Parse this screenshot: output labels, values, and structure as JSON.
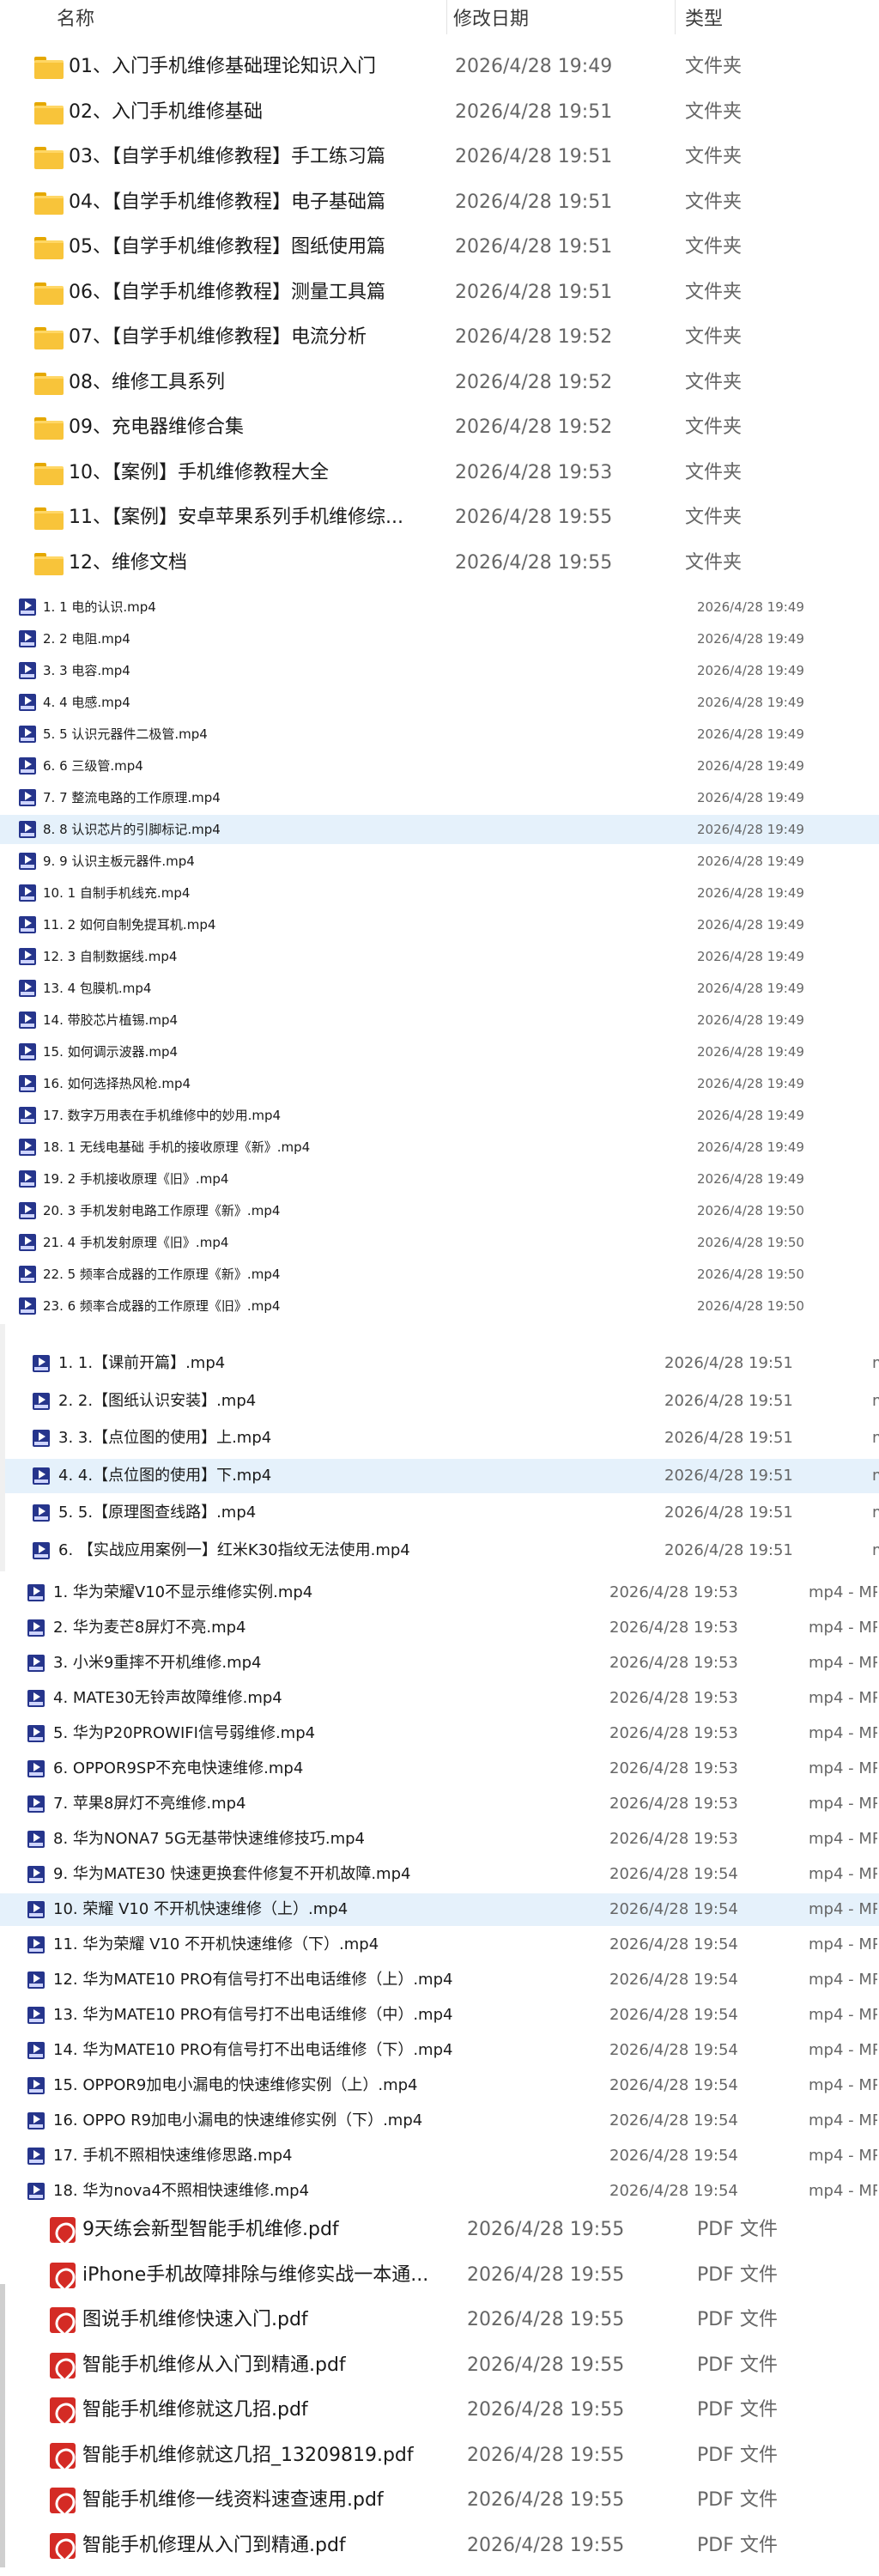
{
  "header": {
    "name": "名称",
    "date": "修改日期",
    "type": "类型"
  },
  "folders": [
    {
      "name": "01、入门手机维修基础理论知识入门",
      "date": "2026/4/28 19:49",
      "type": "文件夹"
    },
    {
      "name": "02、入门手机维修基础",
      "date": "2026/4/28 19:51",
      "type": "文件夹"
    },
    {
      "name": "03、【自学手机维修教程】手工练习篇",
      "date": "2026/4/28 19:51",
      "type": "文件夹"
    },
    {
      "name": "04、【自学手机维修教程】电子基础篇",
      "date": "2026/4/28 19:51",
      "type": "文件夹"
    },
    {
      "name": "05、【自学手机维修教程】图纸使用篇",
      "date": "2026/4/28 19:51",
      "type": "文件夹"
    },
    {
      "name": "06、【自学手机维修教程】测量工具篇",
      "date": "2026/4/28 19:51",
      "type": "文件夹"
    },
    {
      "name": "07、【自学手机维修教程】电流分析",
      "date": "2026/4/28 19:52",
      "type": "文件夹"
    },
    {
      "name": "08、维修工具系列",
      "date": "2026/4/28 19:52",
      "type": "文件夹"
    },
    {
      "name": "09、充电器维修合集",
      "date": "2026/4/28 19:52",
      "type": "文件夹"
    },
    {
      "name": "10、【案例】手机维修教程大全",
      "date": "2026/4/28 19:53",
      "type": "文件夹"
    },
    {
      "name": "11、【案例】安卓苹果系列手机维修综...",
      "date": "2026/4/28 19:55",
      "type": "文件夹"
    },
    {
      "name": "12、维修文档",
      "date": "2026/4/28 19:55",
      "type": "文件夹"
    }
  ],
  "videos_a": [
    {
      "name": "1. 1 电的认识.mp4",
      "date": "2026/4/28 19:49"
    },
    {
      "name": "2. 2 电阻.mp4",
      "date": "2026/4/28 19:49"
    },
    {
      "name": "3. 3 电容.mp4",
      "date": "2026/4/28 19:49"
    },
    {
      "name": "4. 4 电感.mp4",
      "date": "2026/4/28 19:49"
    },
    {
      "name": "5. 5 认识元器件二极管.mp4",
      "date": "2026/4/28 19:49"
    },
    {
      "name": "6. 6 三级管.mp4",
      "date": "2026/4/28 19:49"
    },
    {
      "name": "7. 7 整流电路的工作原理.mp4",
      "date": "2026/4/28 19:49"
    },
    {
      "name": "8. 8 认识芯片的引脚标记.mp4",
      "date": "2026/4/28 19:49",
      "selected": true
    },
    {
      "name": "9. 9 认识主板元器件.mp4",
      "date": "2026/4/28 19:49"
    },
    {
      "name": "10. 1 自制手机线充.mp4",
      "date": "2026/4/28 19:49"
    },
    {
      "name": "11. 2 如何自制免提耳机.mp4",
      "date": "2026/4/28 19:49"
    },
    {
      "name": "12. 3 自制数据线.mp4",
      "date": "2026/4/28 19:49"
    },
    {
      "name": "13. 4 包膜机.mp4",
      "date": "2026/4/28 19:49"
    },
    {
      "name": "14. 带胶芯片植锡.mp4",
      "date": "2026/4/28 19:49"
    },
    {
      "name": "15. 如何调示波器.mp4",
      "date": "2026/4/28 19:49"
    },
    {
      "name": "16. 如何选择热风枪.mp4",
      "date": "2026/4/28 19:49"
    },
    {
      "name": "17. 数字万用表在手机维修中的妙用.mp4",
      "date": "2026/4/28 19:49"
    },
    {
      "name": "18. 1 无线电基础 手机的接收原理《新》.mp4",
      "date": "2026/4/28 19:49"
    },
    {
      "name": "19. 2 手机接收原理《旧》.mp4",
      "date": "2026/4/28 19:49"
    },
    {
      "name": "20. 3 手机发射电路工作原理《新》.mp4",
      "date": "2026/4/28 19:50"
    },
    {
      "name": "21. 4 手机发射原理《旧》.mp4",
      "date": "2026/4/28 19:50"
    },
    {
      "name": "22. 5 频率合成器的工作原理《新》.mp4",
      "date": "2026/4/28 19:50"
    },
    {
      "name": "23. 6 频率合成器的工作原理《旧》.mp4",
      "date": "2026/4/28 19:50"
    }
  ],
  "videos_b": [
    {
      "name": "1. 1.【课前开篇】.mp4",
      "date": "2026/4/28 19:51",
      "type": "m"
    },
    {
      "name": "2. 2.【图纸认识安装】.mp4",
      "date": "2026/4/28 19:51",
      "type": "m"
    },
    {
      "name": "3. 3.【点位图的使用】上.mp4",
      "date": "2026/4/28 19:51",
      "type": "m"
    },
    {
      "name": "4. 4.【点位图的使用】下.mp4",
      "date": "2026/4/28 19:51",
      "type": "m",
      "selected": true
    },
    {
      "name": "5. 5.【原理图查线路】.mp4",
      "date": "2026/4/28 19:51",
      "type": "m"
    },
    {
      "name": "6. 【实战应用案例一】红米K30指纹无法使用.mp4",
      "date": "2026/4/28 19:51",
      "type": "m"
    }
  ],
  "videos_c": [
    {
      "name": "1. 华为荣耀V10不显示维修实例.mp4",
      "date": "2026/4/28 19:53",
      "type": "mp4 - MP"
    },
    {
      "name": "2. 华为麦芒8屏灯不亮.mp4",
      "date": "2026/4/28 19:53",
      "type": "mp4 - MP"
    },
    {
      "name": "3. 小米9重摔不开机维修.mp4",
      "date": "2026/4/28 19:53",
      "type": "mp4 - MP"
    },
    {
      "name": "4. MATE30无铃声故障维修.mp4",
      "date": "2026/4/28 19:53",
      "type": "mp4 - MP"
    },
    {
      "name": "5. 华为P20PROWIFI信号弱维修.mp4",
      "date": "2026/4/28 19:53",
      "type": "mp4 - MP"
    },
    {
      "name": "6. OPPOR9SP不充电快速维修.mp4",
      "date": "2026/4/28 19:53",
      "type": "mp4 - MP"
    },
    {
      "name": "7. 苹果8屏灯不亮维修.mp4",
      "date": "2026/4/28 19:53",
      "type": "mp4 - MP"
    },
    {
      "name": "8. 华为NONA7 5G无基带快速维修技巧.mp4",
      "date": "2026/4/28 19:53",
      "type": "mp4 - MP"
    },
    {
      "name": "9. 华为MATE30 快速更换套件修复不开机故障.mp4",
      "date": "2026/4/28 19:54",
      "type": "mp4 - MP"
    },
    {
      "name": "10. 荣耀 V10 不开机快速维修（上）.mp4",
      "date": "2026/4/28 19:54",
      "type": "mp4 - MP",
      "selected": true
    },
    {
      "name": "11. 华为荣耀 V10 不开机快速维修（下）.mp4",
      "date": "2026/4/28 19:54",
      "type": "mp4 - MP"
    },
    {
      "name": "12. 华为MATE10 PRO有信号打不出电话维修（上）.mp4",
      "date": "2026/4/28 19:54",
      "type": "mp4 - MP"
    },
    {
      "name": "13. 华为MATE10 PRO有信号打不出电话维修（中）.mp4",
      "date": "2026/4/28 19:54",
      "type": "mp4 - MP"
    },
    {
      "name": "14. 华为MATE10 PRO有信号打不出电话维修（下）.mp4",
      "date": "2026/4/28 19:54",
      "type": "mp4 - MP"
    },
    {
      "name": "15. OPPOR9加电小漏电的快速维修实例（上）.mp4",
      "date": "2026/4/28 19:54",
      "type": "mp4 - MP"
    },
    {
      "name": "16. OPPO R9加电小漏电的快速维修实例（下）.mp4",
      "date": "2026/4/28 19:54",
      "type": "mp4 - MP"
    },
    {
      "name": "17. 手机不照相快速维修思路.mp4",
      "date": "2026/4/28 19:54",
      "type": "mp4 - MP"
    },
    {
      "name": "18. 华为nova4不照相快速维修.mp4",
      "date": "2026/4/28 19:54",
      "type": "mp4 - MP"
    }
  ],
  "pdfs": [
    {
      "name": "9天练会新型智能手机维修.pdf",
      "date": "2026/4/28 19:55",
      "type": "PDF 文件"
    },
    {
      "name": "iPhone手机故障排除与维修实战一本通...",
      "date": "2026/4/28 19:55",
      "type": "PDF 文件"
    },
    {
      "name": "图说手机维修快速入门.pdf",
      "date": "2026/4/28 19:55",
      "type": "PDF 文件"
    },
    {
      "name": "智能手机维修从入门到精通.pdf",
      "date": "2026/4/28 19:55",
      "type": "PDF 文件"
    },
    {
      "name": "智能手机维修就这几招.pdf",
      "date": "2026/4/28 19:55",
      "type": "PDF 文件"
    },
    {
      "name": "智能手机维修就这几招_13209819.pdf",
      "date": "2026/4/28 19:55",
      "type": "PDF 文件"
    },
    {
      "name": "智能手机维修一线资料速查速用.pdf",
      "date": "2026/4/28 19:55",
      "type": "PDF 文件"
    },
    {
      "name": "智能手机修理从入门到精通.pdf",
      "date": "2026/4/28 19:55",
      "type": "PDF 文件"
    }
  ]
}
